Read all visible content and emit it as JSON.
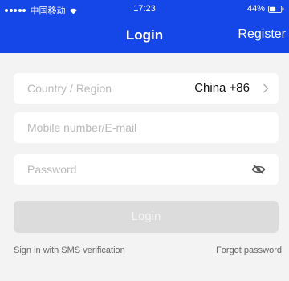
{
  "status_bar": {
    "carrier": "中国移动",
    "time": "17:23",
    "battery": "44%"
  },
  "nav": {
    "title": "Login",
    "register": "Register"
  },
  "form": {
    "country_label": "Country / Region",
    "country_value": "China +86",
    "mobile_placeholder": "Mobile number/E-mail",
    "password_placeholder": "Password"
  },
  "actions": {
    "login": "Login",
    "sms": "Sign in with SMS verification",
    "forgot": "Forgot password"
  },
  "colors": {
    "primary": "#1446e8",
    "background": "#f3f3f3",
    "disabled_button": "#dcdcdc"
  },
  "icons": [
    "signal-icon",
    "wifi-icon",
    "battery-icon",
    "chevron-right-icon",
    "eye-off-icon"
  ]
}
